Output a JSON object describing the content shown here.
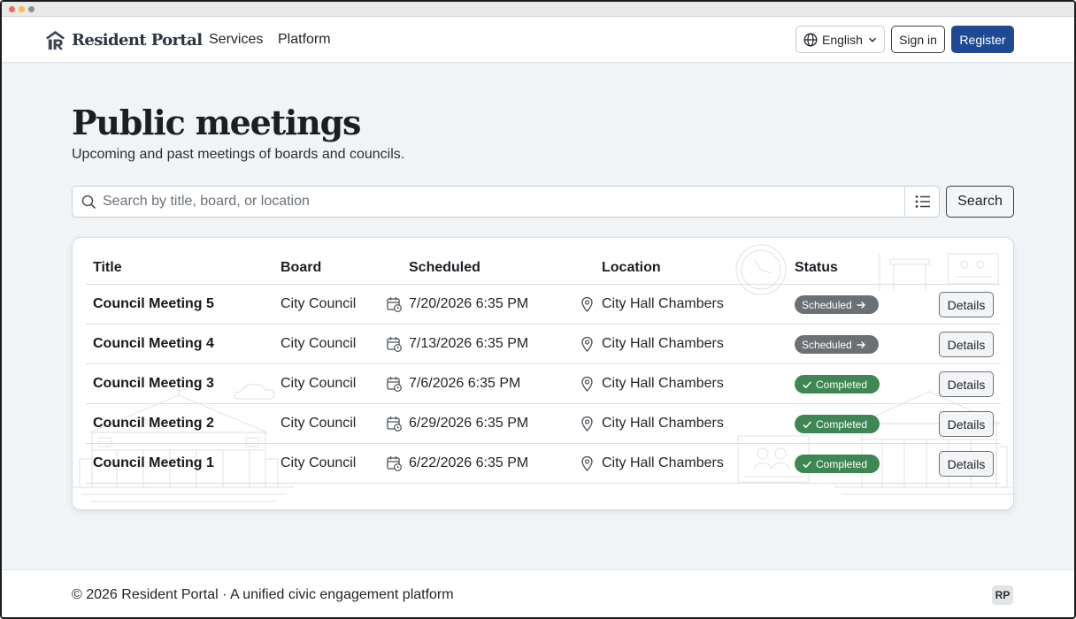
{
  "window": {
    "controls": [
      "close",
      "minimize",
      "zoom"
    ]
  },
  "header": {
    "brand": "Resident Portal",
    "nav": [
      "Services",
      "Platform"
    ],
    "language": "English",
    "sign_in": "Sign in",
    "register": "Register"
  },
  "page": {
    "title": "Public meetings",
    "subtitle": "Upcoming and past meetings of boards and councils."
  },
  "search": {
    "placeholder": "Search by title, board, or location",
    "value": "",
    "button": "Search"
  },
  "table": {
    "columns": [
      "Title",
      "Board",
      "Scheduled",
      "Location",
      "Status"
    ],
    "rows": [
      {
        "title": "Council Meeting 5",
        "board": "City Council",
        "scheduled": "7/20/2026 6:35 PM",
        "location": "City Hall Chambers",
        "status": "Scheduled",
        "action": "Details"
      },
      {
        "title": "Council Meeting 4",
        "board": "City Council",
        "scheduled": "7/13/2026 6:35 PM",
        "location": "City Hall Chambers",
        "status": "Scheduled",
        "action": "Details"
      },
      {
        "title": "Council Meeting 3",
        "board": "City Council",
        "scheduled": "7/6/2026 6:35 PM",
        "location": "City Hall Chambers",
        "status": "Completed",
        "action": "Details"
      },
      {
        "title": "Council Meeting 2",
        "board": "City Council",
        "scheduled": "6/29/2026 6:35 PM",
        "location": "City Hall Chambers",
        "status": "Completed",
        "action": "Details"
      },
      {
        "title": "Council Meeting 1",
        "board": "City Council",
        "scheduled": "6/22/2026 6:35 PM",
        "location": "City Hall Chambers",
        "status": "Completed",
        "action": "Details"
      }
    ]
  },
  "footer": {
    "text": "© 2026 Resident Portal · A unified civic engagement platform",
    "badge": "RP"
  },
  "icons": {
    "brand": "building-logo-icon",
    "language": "globe-icon",
    "dropdown": "chevron-down-icon",
    "search": "search-icon",
    "view": "list-view-icon",
    "date": "calendar-clock-icon",
    "location": "map-pin-icon",
    "scheduled": "arrow-right-icon",
    "completed": "check-icon"
  },
  "colors": {
    "primary": "#1f4a93",
    "scheduled_badge": "#6b7075",
    "completed_badge": "#3e8654",
    "page_background": "#f1f4f7"
  }
}
